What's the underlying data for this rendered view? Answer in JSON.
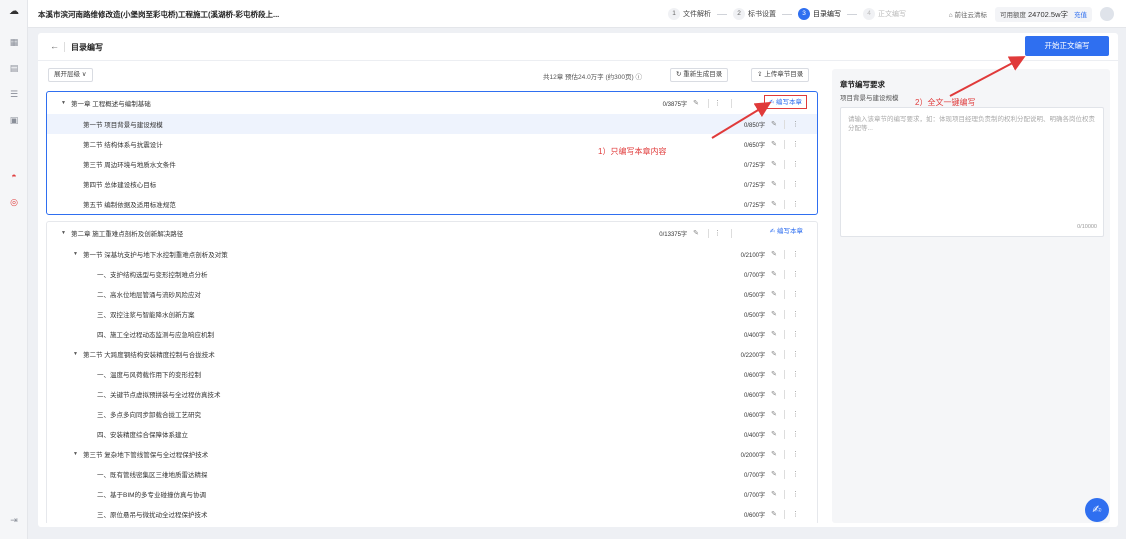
{
  "topbar": {
    "title": "本溪市滨河南路维修改造(小堡岗至彩屯桥)工程施工(溪湖桥-彩屯桥段上...",
    "steps": [
      {
        "num": "1",
        "label": "文件解析"
      },
      {
        "num": "2",
        "label": "标书设置"
      },
      {
        "num": "3",
        "label": "目录编写"
      },
      {
        "num": "4",
        "label": "正文编写"
      }
    ],
    "cloud_link": "前往云清标",
    "balance_label": "可用额度",
    "balance_value": "24702.5w字",
    "charge": "充值"
  },
  "header": {
    "back": "←",
    "title": "目录编写",
    "start_button": "开始正文编写"
  },
  "toolbar": {
    "expand": "展开层级 ∨",
    "summary": "共12章 预估24.0万字 (约300页) ⓘ",
    "regenerate": "重新生成目录",
    "upload": "上传章节目录"
  },
  "chapters": [
    {
      "title": "第一章 工程概述与编制基础",
      "count": "0/3875字",
      "write_label": "编写本章",
      "items": [
        {
          "title": "第一节 项目背景与建设规模",
          "count": "0/850字"
        },
        {
          "title": "第二节 结构体系与抗震设计",
          "count": "0/650字"
        },
        {
          "title": "第三节 周边环境与地质水文条件",
          "count": "0/725字"
        },
        {
          "title": "第四节 总体建设核心目标",
          "count": "0/725字"
        },
        {
          "title": "第五节 编制依据及适用标准规范",
          "count": "0/725字"
        }
      ]
    },
    {
      "title": "第二章 施工重难点剖析及创新解决路径",
      "count": "0/13375字",
      "write_label": "编写本章",
      "sections": [
        {
          "title": "第一节 深基坑支护与地下水控制重难点剖析及对策",
          "count": "0/2100字",
          "items": [
            {
              "title": "一、支护结构选型与变形控制难点分析",
              "count": "0/700字"
            },
            {
              "title": "二、高水位地层管涌与流砂风险应对",
              "count": "0/500字"
            },
            {
              "title": "三、双控注浆与智能降水创新方案",
              "count": "0/500字"
            },
            {
              "title": "四、施工全过程动态监测与应急响应机制",
              "count": "0/400字"
            }
          ]
        },
        {
          "title": "第二节 大跨度钢结构安装精度控制与合拢技术",
          "count": "0/2200字",
          "items": [
            {
              "title": "一、温度与风荷载作用下的变形控制",
              "count": "0/600字"
            },
            {
              "title": "二、关键节点虚拟预拼装与全过程仿真技术",
              "count": "0/600字"
            },
            {
              "title": "三、多点多向同步卸载合拢工艺研究",
              "count": "0/600字"
            },
            {
              "title": "四、安装精度综合保障体系建立",
              "count": "0/400字"
            }
          ]
        },
        {
          "title": "第三节 复杂地下管线管保与全过程保护技术",
          "count": "0/2000字",
          "items": [
            {
              "title": "一、既有管线密集区三维地质雷达精探",
              "count": "0/700字"
            },
            {
              "title": "二、基于BIM的多专业碰撞仿真与协调",
              "count": "0/700字"
            },
            {
              "title": "三、原位悬吊与微扰动全过程保护技术",
              "count": "0/600字"
            }
          ]
        }
      ]
    }
  ],
  "right_panel": {
    "title": "章节编写要求",
    "subtitle": "项目背景与建设规模",
    "placeholder": "请输入该章节的编写要求，如：体现项目经理负责制的权利分配说明、明确各岗位权责分配等...",
    "char_count": "0/10000"
  },
  "annotations": {
    "one": "1）只编写本章内容",
    "two": "2）全文一键编写"
  },
  "icons": {
    "edit": "✎",
    "more": "⋮",
    "write": "✍"
  },
  "colors": {
    "accent": "#2f6ff0",
    "annotation": "#e03a3a"
  }
}
